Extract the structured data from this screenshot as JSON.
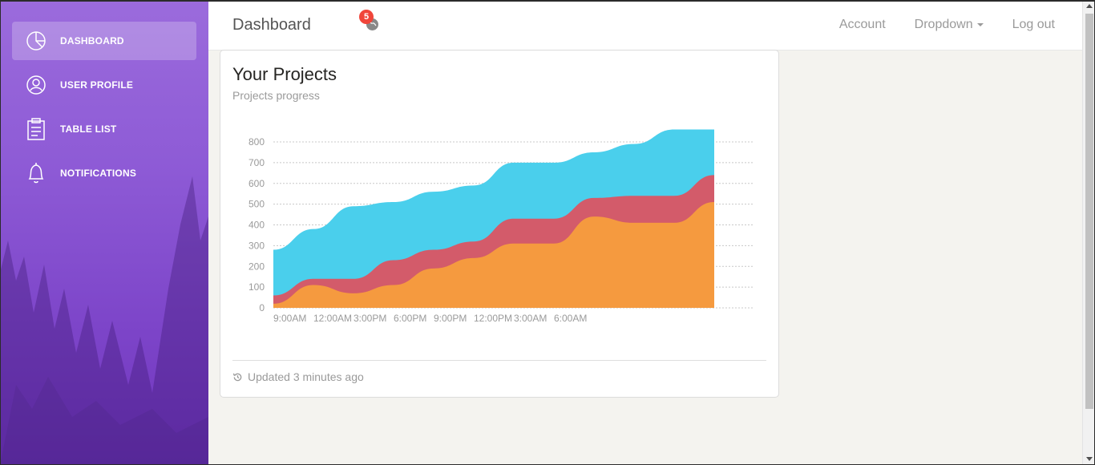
{
  "sidebar": {
    "items": [
      {
        "label": "DASHBOARD",
        "icon": "pie-chart-icon",
        "active": true
      },
      {
        "label": "USER PROFILE",
        "icon": "user-icon",
        "active": false
      },
      {
        "label": "TABLE LIST",
        "icon": "clipboard-icon",
        "active": false
      },
      {
        "label": "NOTIFICATIONS",
        "icon": "bell-icon",
        "active": false
      }
    ]
  },
  "topbar": {
    "title": "Dashboard",
    "notification_count": "5",
    "account": "Account",
    "dropdown": "Dropdown",
    "logout": "Log out"
  },
  "card": {
    "title": "Your Projects",
    "subtitle": "Projects progress",
    "footer": "Updated 3 minutes ago"
  },
  "colors": {
    "cyan": "#4acfec",
    "red": "#d35b6a",
    "orange": "#f59a3f",
    "accent": "#9368e9"
  },
  "chart_data": {
    "type": "area",
    "stacked": true,
    "x_labels": [
      "9:00AM",
      "12:00AM",
      "3:00PM",
      "6:00PM",
      "9:00PM",
      "12:00PM",
      "3:00AM",
      "6:00AM"
    ],
    "x_points": 12,
    "yticks": [
      0,
      100,
      200,
      300,
      400,
      500,
      600,
      700,
      800
    ],
    "ylim": [
      0,
      800
    ],
    "grid": true,
    "series": [
      {
        "color": "#f59a3f",
        "values": [
          20,
          110,
          70,
          110,
          190,
          240,
          310,
          310,
          440,
          410,
          410,
          510
        ]
      },
      {
        "color": "#d35b6a",
        "values": [
          40,
          30,
          70,
          120,
          90,
          80,
          120,
          120,
          90,
          130,
          130,
          130
        ]
      },
      {
        "color": "#4acfec",
        "values": [
          220,
          240,
          350,
          280,
          280,
          270,
          270,
          270,
          220,
          250,
          320,
          220
        ]
      }
    ]
  }
}
